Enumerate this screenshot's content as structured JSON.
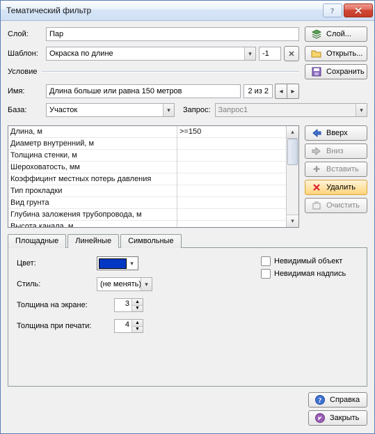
{
  "window": {
    "title": "Тематический фильтр"
  },
  "labels": {
    "layer": "Слой:",
    "template": "Шаблон:",
    "condition": "Условие",
    "name": "Имя:",
    "base": "База:",
    "query": "Запрос:"
  },
  "fields": {
    "layer": "Пар",
    "template": "Окраска по длине",
    "template_index": "-1",
    "name": "Длина больше или равна 150 метров",
    "nav_count": "2 из 2",
    "base": "Участок",
    "query": "Запрос1"
  },
  "buttons": {
    "layer": "Слой...",
    "open": "Открыть...",
    "save": "Сохранить",
    "up": "Вверх",
    "down": "Вниз",
    "insert": "Вставить",
    "delete": "Удалить",
    "clear": "Очистить",
    "help": "Справка",
    "close": "Закрыть"
  },
  "table": {
    "rows": [
      {
        "name": "Длина, м",
        "value": ">=150"
      },
      {
        "name": "Диаметр внутренний, м",
        "value": ""
      },
      {
        "name": "Толщина стенки, м",
        "value": ""
      },
      {
        "name": "Шероховатость, мм",
        "value": ""
      },
      {
        "name": "Коэффицинт местных потерь давления",
        "value": ""
      },
      {
        "name": "Тип прокладки",
        "value": ""
      },
      {
        "name": "Вид грунта",
        "value": ""
      },
      {
        "name": "Глубина заложения трубопровода, м",
        "value": ""
      },
      {
        "name": "Высота канала, м",
        "value": ""
      }
    ]
  },
  "tabs": {
    "area": "Площадные",
    "line": "Линейные",
    "symbol": "Символьные"
  },
  "panel": {
    "color_label": "Цвет:",
    "style_label": "Стиль:",
    "style_value": "(не менять)",
    "screen_thickness_label": "Толщина на экране:",
    "screen_thickness_value": "3",
    "print_thickness_label": "Толщина при печати:",
    "print_thickness_value": "4",
    "color_hex": "#0037c3"
  },
  "checks": {
    "invisible_object": "Невидимый объект",
    "invisible_label": "Невидимая надпись"
  }
}
